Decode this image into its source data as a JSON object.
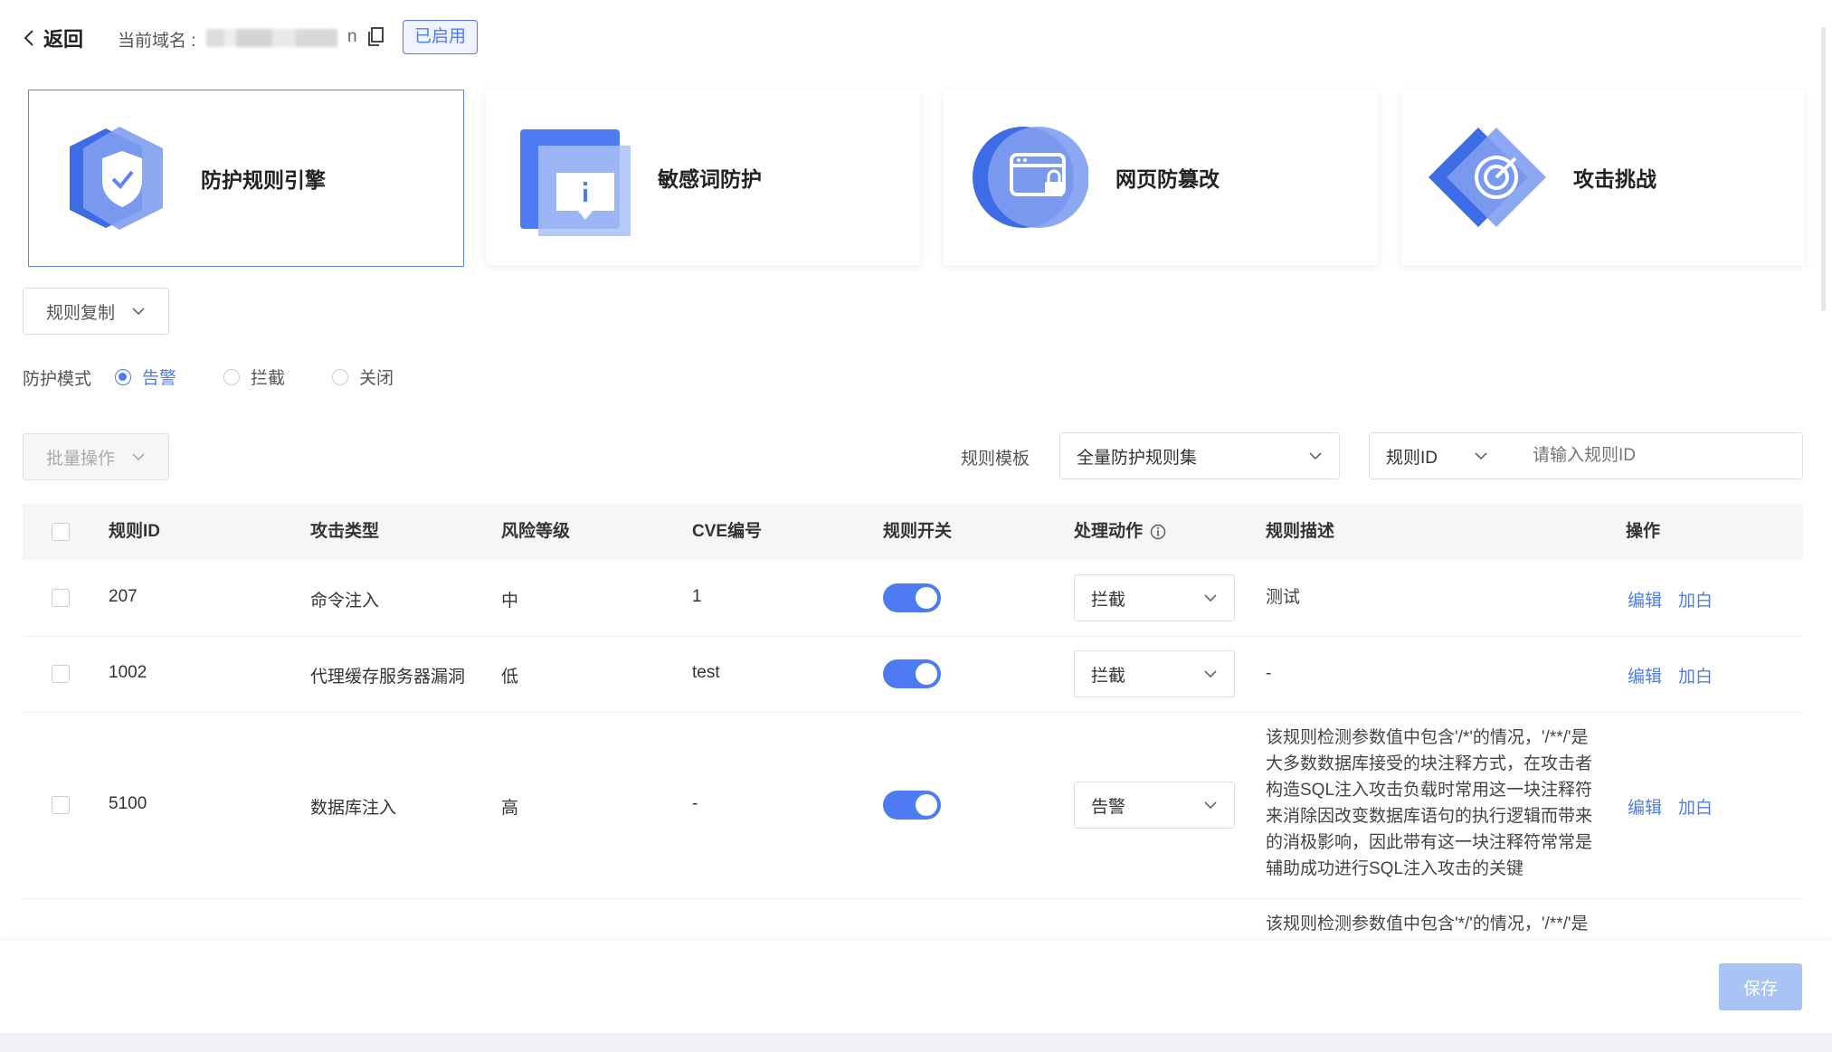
{
  "header": {
    "back_label": "返回",
    "domain_label": "当前域名 :",
    "domain_tail": "n",
    "status_tag": "已启用"
  },
  "cards": [
    {
      "title": "防护规则引擎",
      "icon": "shield-icon"
    },
    {
      "title": "敏感词防护",
      "icon": "info-icon"
    },
    {
      "title": "网页防篡改",
      "icon": "lock-browser-icon"
    },
    {
      "title": "攻击挑战",
      "icon": "target-icon"
    }
  ],
  "rule_copy_label": "规则复制",
  "protection_mode": {
    "label": "防护模式",
    "options": [
      "告警",
      "拦截",
      "关闭"
    ],
    "selected": "告警"
  },
  "batch_label": "批量操作",
  "template": {
    "label": "规则模板",
    "selected": "全量防护规则集"
  },
  "search": {
    "field": "规则ID",
    "placeholder": "请输入规则ID"
  },
  "table": {
    "columns": [
      "规则ID",
      "攻击类型",
      "风险等级",
      "CVE编号",
      "规则开关",
      "处理动作",
      "规则描述",
      "操作"
    ],
    "rows": [
      {
        "id": "207",
        "type": "命令注入",
        "risk": "中",
        "cve": "1",
        "enabled": true,
        "action": "拦截",
        "desc": "测试",
        "edit": "编辑",
        "whitelist": "加白"
      },
      {
        "id": "1002",
        "type": "代理缓存服务器漏洞",
        "risk": "低",
        "cve": "test",
        "enabled": true,
        "action": "拦截",
        "desc": "-",
        "edit": "编辑",
        "whitelist": "加白"
      },
      {
        "id": "5100",
        "type": "数据库注入",
        "risk": "高",
        "cve": "-",
        "enabled": true,
        "action": "告警",
        "desc": "该规则检测参数值中包含'/*'的情况，'/**/'是大多数数据库接受的块注释方式，在攻击者构造SQL注入攻击负载时常用这一块注释符来消除因改变数据库语句的执行逻辑而带来的消极影响，因此带有这一块注释符常常是辅助成功进行SQL注入攻击的关键",
        "edit": "编辑",
        "whitelist": "加白"
      }
    ],
    "partial_desc": "该规则检测参数值中包含'*/'的情况，'/**/'是"
  },
  "save_label": "保存",
  "colors": {
    "accent": "#4d7cf2"
  }
}
